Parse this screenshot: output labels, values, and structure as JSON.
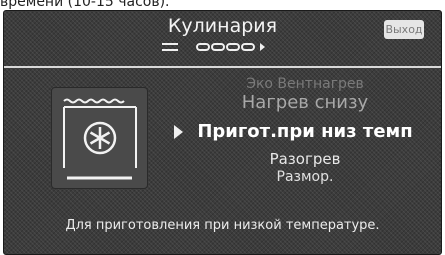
{
  "caption": "времени (10-15 часов).",
  "header": {
    "title": "Кулинария",
    "exit_label": "Выход"
  },
  "wizard_progress": {
    "total_steps": 4,
    "current_step": 0
  },
  "mode_list": {
    "items": [
      "Эко Вентнагрев",
      "Нагрев снизу",
      "Пригот.при низ темп",
      "Разогрев",
      "Размор."
    ],
    "selected": "Пригот.при низ темп"
  },
  "description": "Для приготовления при низкой температуре.",
  "icons": {
    "oven_mode": "oven-fan-low-heat-icon",
    "selector": "selector-arrow-icon"
  },
  "colors": {
    "screen_bg": "#3c3c3c",
    "text_primary": "#ffffff",
    "text_dim": "#7a7a7a",
    "button_bg": "#e6e6e6"
  }
}
